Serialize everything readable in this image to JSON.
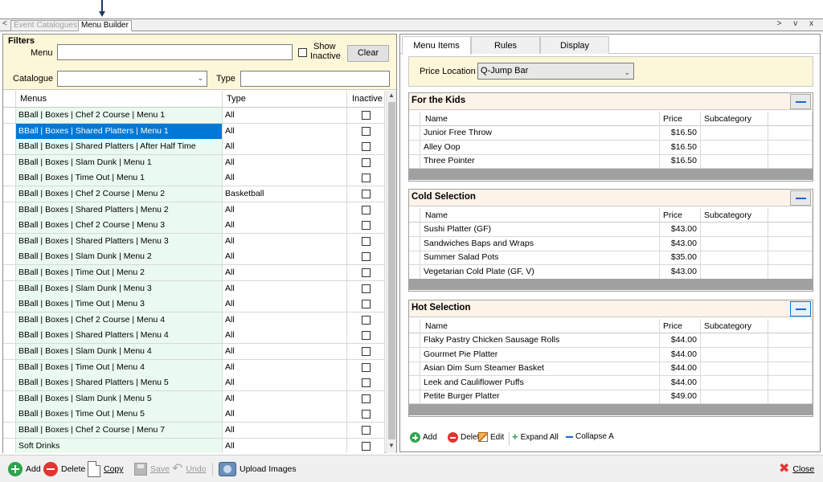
{
  "document_tabs": {
    "nav_left": "<",
    "items": [
      {
        "label": "Event Catalogues",
        "active": false
      },
      {
        "label": "Menu Builder",
        "active": true
      }
    ],
    "window_controls": "> v x"
  },
  "filters": {
    "title": "Filters",
    "menu_label": "Menu",
    "menu_value": "",
    "show_inactive_label_1": "Show",
    "show_inactive_label_2": "Inactive",
    "clear_label": "Clear",
    "catalogue_label": "Catalogue",
    "catalogue_value": "",
    "type_label": "Type",
    "type_value": ""
  },
  "menus_grid": {
    "columns": [
      "Menus",
      "Type",
      "Inactive"
    ],
    "rows": [
      {
        "menu": "BBall | Boxes | Chef 2 Course | Menu 1",
        "type": "All"
      },
      {
        "menu": "BBall | Boxes | Shared Platters | Menu 1",
        "type": "All",
        "selected": true
      },
      {
        "menu": "BBall | Boxes | Shared Platters | After Half Time",
        "type": "All"
      },
      {
        "menu": "BBall | Boxes | Slam Dunk | Menu 1",
        "type": "All"
      },
      {
        "menu": "BBall | Boxes | Time Out | Menu 1",
        "type": "All"
      },
      {
        "menu": "BBall | Boxes | Chef 2 Course | Menu 2",
        "type": "Basketball"
      },
      {
        "menu": "BBall | Boxes | Shared Platters | Menu 2",
        "type": "All"
      },
      {
        "menu": "BBall | Boxes | Chef 2 Course | Menu 3",
        "type": "All"
      },
      {
        "menu": "BBall | Boxes | Shared Platters | Menu 3",
        "type": "All"
      },
      {
        "menu": "BBall | Boxes | Slam Dunk | Menu 2",
        "type": "All"
      },
      {
        "menu": "BBall | Boxes | Time Out | Menu 2",
        "type": "All"
      },
      {
        "menu": "BBall | Boxes | Slam Dunk | Menu 3",
        "type": "All"
      },
      {
        "menu": "BBall | Boxes | Time Out | Menu 3",
        "type": "All"
      },
      {
        "menu": "BBall | Boxes | Chef 2 Course | Menu 4",
        "type": "All"
      },
      {
        "menu": "BBall | Boxes | Shared Platters | Menu 4",
        "type": "All"
      },
      {
        "menu": "BBall | Boxes | Slam Dunk | Menu 4",
        "type": "All"
      },
      {
        "menu": "BBall | Boxes | Time Out | Menu 4",
        "type": "All"
      },
      {
        "menu": "BBall | Boxes | Shared Platters | Menu 5",
        "type": "All"
      },
      {
        "menu": "BBall | Boxes | Slam Dunk | Menu 5",
        "type": "All"
      },
      {
        "menu": "BBall | Boxes | Time Out | Menu 5",
        "type": "All"
      },
      {
        "menu": "BBall | Boxes | Chef 2 Course | Menu 7",
        "type": "All"
      },
      {
        "menu": "Soft Drinks",
        "type": "All"
      }
    ]
  },
  "right_tabs": [
    "Menu Items",
    "Rules",
    "Display"
  ],
  "price_location": {
    "label": "Price Location",
    "value": "Q-Jump Bar"
  },
  "sections": [
    {
      "title": "For the Kids",
      "columns": [
        "Name",
        "Price",
        "Subcategory"
      ],
      "items": [
        {
          "name": "Junior Free Throw",
          "price": "$16.50",
          "subcategory": ""
        },
        {
          "name": "Alley Oop",
          "price": "$16.50",
          "subcategory": ""
        },
        {
          "name": "Three Pointer",
          "price": "$16.50",
          "subcategory": ""
        }
      ]
    },
    {
      "title": "Cold Selection",
      "columns": [
        "Name",
        "Price",
        "Subcategory"
      ],
      "items": [
        {
          "name": "Sushi Platter (GF)",
          "price": "$43.00",
          "subcategory": ""
        },
        {
          "name": "Sandwiches Baps and Wraps",
          "price": "$43.00",
          "subcategory": ""
        },
        {
          "name": "Summer Salad Pots",
          "price": "$35.00",
          "subcategory": ""
        },
        {
          "name": "Vegetarian Cold Plate (GF, V)",
          "price": "$43.00",
          "subcategory": ""
        }
      ]
    },
    {
      "title": "Hot Selection",
      "columns": [
        "Name",
        "Price",
        "Subcategory"
      ],
      "items": [
        {
          "name": "Flaky Pastry Chicken Sausage Rolls",
          "price": "$44.00",
          "subcategory": ""
        },
        {
          "name": "Gourmet Pie Platter",
          "price": "$44.00",
          "subcategory": ""
        },
        {
          "name": "Asian Dim Sum Steamer Basket",
          "price": "$44.00",
          "subcategory": ""
        },
        {
          "name": "Leek and Cauliflower Puffs",
          "price": "$44.00",
          "subcategory": ""
        },
        {
          "name": "Petite Burger Platter",
          "price": "$49.00",
          "subcategory": ""
        }
      ]
    }
  ],
  "right_toolbar": {
    "add": "Add",
    "delete": "Delete",
    "edit": "Edit",
    "expand_all": "Expand All",
    "collapse_all": "Collapse A"
  },
  "bottom_toolbar": {
    "add": "Add",
    "delete": "Delete",
    "copy": "Copy",
    "save": "Save",
    "undo": "Undo",
    "upload_images": "Upload Images",
    "close": "Close"
  },
  "colors": {
    "filter_bg": "#fdf7d9",
    "menu_cell_bg": "#eafaf0",
    "selection": "#0078d7",
    "section_header_bg": "#fdf3e8"
  }
}
